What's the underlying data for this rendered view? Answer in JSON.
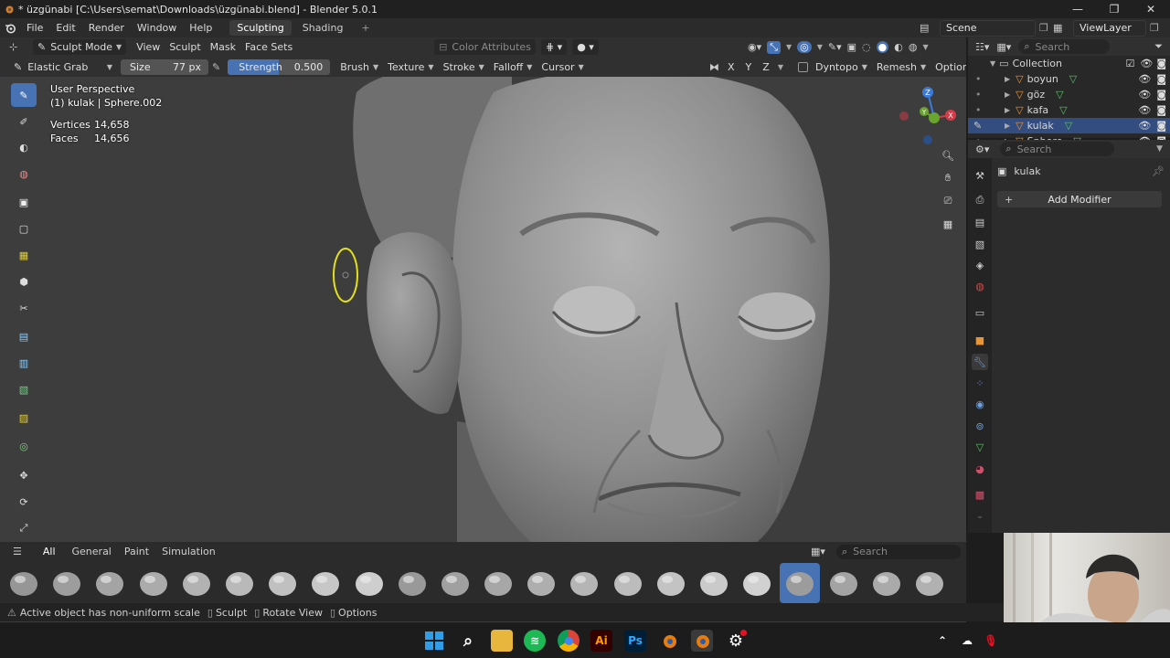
{
  "window": {
    "title": "* üzgünabi [C:\\Users\\semat\\Downloads\\üzgünabi.blend] - Blender 5.0.1",
    "minimize": "—",
    "maximize": "❐",
    "close": "✕"
  },
  "menu": {
    "items": [
      "File",
      "Edit",
      "Render",
      "Window",
      "Help"
    ],
    "workspace_tabs": [
      "Sculpting",
      "Shading"
    ],
    "add_tab": "+",
    "scene": "Scene",
    "view_layer": "ViewLayer"
  },
  "viewport_header": {
    "mode": "Sculpt Mode",
    "menus": [
      "View",
      "Sculpt",
      "Mask",
      "Face Sets"
    ],
    "color_attributes": "Color Attributes"
  },
  "tool_settings": {
    "brush_name": "Elastic Grab",
    "size_label": "Size",
    "size_value": "77 px",
    "strength_label": "Strength",
    "strength_value": "0.500",
    "menus": [
      "Brush",
      "Texture",
      "Stroke",
      "Falloff",
      "Cursor"
    ],
    "axes": [
      "X",
      "Y",
      "Z"
    ],
    "dyntopo": "Dyntopo",
    "remesh": "Remesh",
    "options": "Options"
  },
  "overlay": {
    "perspective": "User Perspective",
    "object": "(1) kulak | Sphere.002",
    "vertices_label": "Vertices",
    "vertices_value": "14,658",
    "faces_label": "Faces",
    "faces_value": "14,656"
  },
  "gizmo": {
    "z": "Z",
    "y": "Y",
    "x": "X"
  },
  "asset_shelf": {
    "tabs": [
      "All",
      "General",
      "Paint",
      "Simulation"
    ],
    "search_placeholder": "Search",
    "selected_brush_index": 18
  },
  "status_bar": {
    "message": "Active object has non-uniform scale",
    "sculpt": "Sculpt",
    "rotate": "Rotate View",
    "options": "Options"
  },
  "outliner": {
    "search_placeholder": "Search",
    "collection": "Collection",
    "items": [
      "boyun",
      "göz",
      "kafa",
      "kulak",
      "Sphere"
    ],
    "selected": "kulak"
  },
  "properties": {
    "search_placeholder": "Search",
    "object_name": "kulak",
    "add_modifier": "Add Modifier"
  },
  "colors": {
    "accent": "#4772b3",
    "viewport_bg": "#3d3d3d",
    "header_bg": "#303030"
  }
}
